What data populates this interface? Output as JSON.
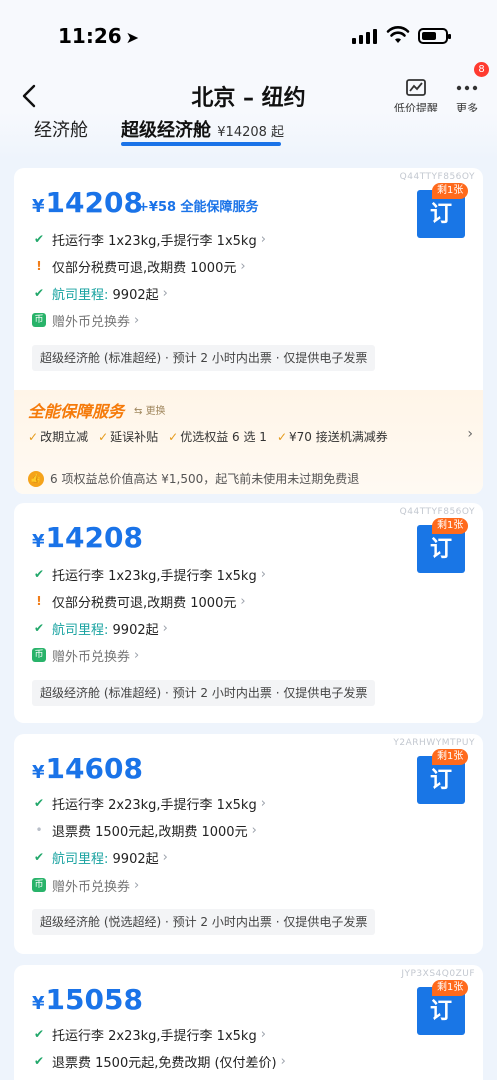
{
  "status": {
    "time": "11:26"
  },
  "nav": {
    "title": "北京 – 纽约",
    "price_alert": "低价提醒",
    "more": "更多",
    "badge": "8"
  },
  "tabs": {
    "economy": "经济舱",
    "premium": "超级经济舱",
    "premium_price": "¥14208 起"
  },
  "cards": [
    {
      "code": "Q44TTYF856OY",
      "currency": "¥",
      "price": "14208",
      "service_tag": "+¥58 全能保障服务",
      "book": "订",
      "remaining": "剩1张",
      "baggage": "托运行李 1x23kg,手提行李 1x5kg",
      "refund": "仅部分税费可退,改期费 1000元",
      "mileage_label": "航司里程:",
      "mileage_value": "9902起",
      "coupon": "赠外币兑换券",
      "info": "超级经济舱 (标准超经) · 预计 2 小时内出票 · 仅提供电子发票",
      "service_panel": {
        "title": "全能保障服务",
        "switch": "更换",
        "items": [
          "改期立减",
          "延误补贴",
          "优选权益 6 选 1",
          "¥70 接送机满减券"
        ],
        "note": "6 项权益总价值高达 ¥1,500，起飞前未使用未过期免费退"
      }
    },
    {
      "code": "Q44TTYF856OY",
      "currency": "¥",
      "price": "14208",
      "book": "订",
      "remaining": "剩1张",
      "baggage": "托运行李 1x23kg,手提行李 1x5kg",
      "refund": "仅部分税费可退,改期费 1000元",
      "mileage_label": "航司里程:",
      "mileage_value": "9902起",
      "coupon": "赠外币兑换券",
      "info": "超级经济舱 (标准超经) · 预计 2 小时内出票 · 仅提供电子发票"
    },
    {
      "code": "Y2ARHWYMTPUY",
      "currency": "¥",
      "price": "14608",
      "book": "订",
      "remaining": "剩1张",
      "baggage": "托运行李 2x23kg,手提行李 1x5kg",
      "refund": "退票费 1500元起,改期费 1000元",
      "mileage_label": "航司里程:",
      "mileage_value": "9902起",
      "coupon": "赠外币兑换券",
      "info": "超级经济舱 (悦选超经) · 预计 2 小时内出票 · 仅提供电子发票"
    },
    {
      "code": "JYP3XS4Q0ZUF",
      "currency": "¥",
      "price": "15058",
      "book": "订",
      "remaining": "剩1张",
      "baggage": "托运行李 2x23kg,手提行李 1x5kg",
      "refund": "退票费 1500元起,免费改期 (仅付差价)"
    }
  ],
  "colors": {
    "accent": "#1a73e8",
    "orange": "#ff6a1c",
    "green": "#22a86b"
  }
}
